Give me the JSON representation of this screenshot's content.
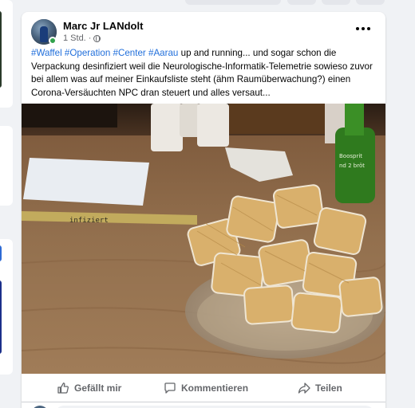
{
  "post": {
    "author": "Marc Jr LANdolt",
    "time": "1 Std.",
    "privacy_icon": "globe-icon",
    "hashtags": [
      "#Waffel",
      "#Operation",
      "#Center",
      "#Aarau"
    ],
    "text_after_tags": "up and running... und sogar schon die Verpackung desinfiziert weil die Neurologische-Informatik-Telemetrie sowieso zuvor bei allem was auf meiner Einkaufsliste steht (ähm Raumüberwachung?) einen Corona-Versäuchten NPC dran steuert und alles versaut...",
    "more_icon": "more-options-icon"
  },
  "photo": {
    "tape_text": "infiziert",
    "description_alt": "photo"
  },
  "actions": {
    "like_label": "Gefällt mir",
    "comment_label": "Kommentieren",
    "share_label": "Teilen"
  },
  "colors": {
    "hashtag": "#216fdb",
    "online": "#31a24c",
    "muted": "#65676b"
  }
}
